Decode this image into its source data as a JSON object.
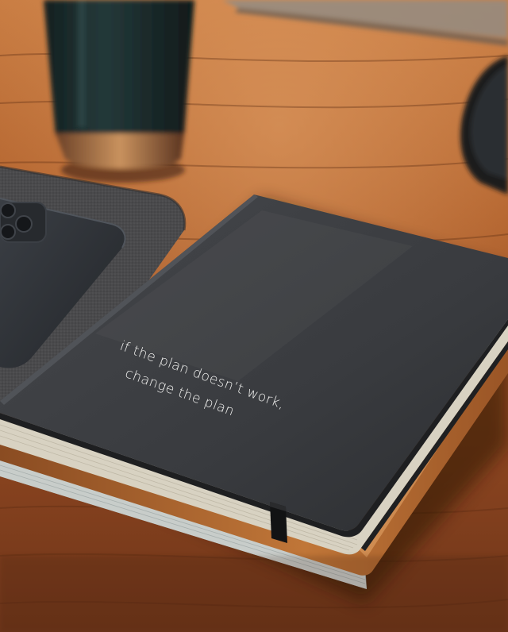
{
  "photo": {
    "subject": "notebook-on-desk",
    "cover_quote": {
      "line1": "if the plan doesn’t work,",
      "line2": "change the plan"
    },
    "colors": {
      "desk": "#a85a2a",
      "desk_dark": "#5e2f14",
      "desk_light": "#d98f54",
      "cover": "#3a3c3f",
      "cover_dark": "#2a2c2f",
      "cover_edge": "#1e1f21",
      "pages": "#d9d4c6",
      "tan_notebook": "#b56a2e",
      "felt_mat": "#48484a",
      "phone": "#2f3237",
      "tumbler": "#1d2a2a",
      "quote_text": "#f2f2f0"
    }
  }
}
